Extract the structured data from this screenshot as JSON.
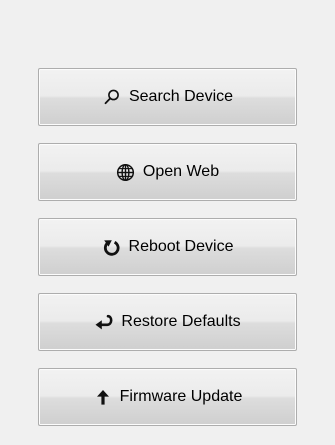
{
  "buttons": [
    {
      "label": "Search Device",
      "icon": "search-icon"
    },
    {
      "label": "Open Web",
      "icon": "globe-icon"
    },
    {
      "label": "Reboot Device",
      "icon": "reboot-icon"
    },
    {
      "label": "Restore Defaults",
      "icon": "restore-icon"
    },
    {
      "label": "Firmware Update",
      "icon": "arrow-up-icon"
    }
  ],
  "colors": {
    "panel_background": "#f0f0f0",
    "button_border": "#adadad",
    "text": "#000000"
  }
}
